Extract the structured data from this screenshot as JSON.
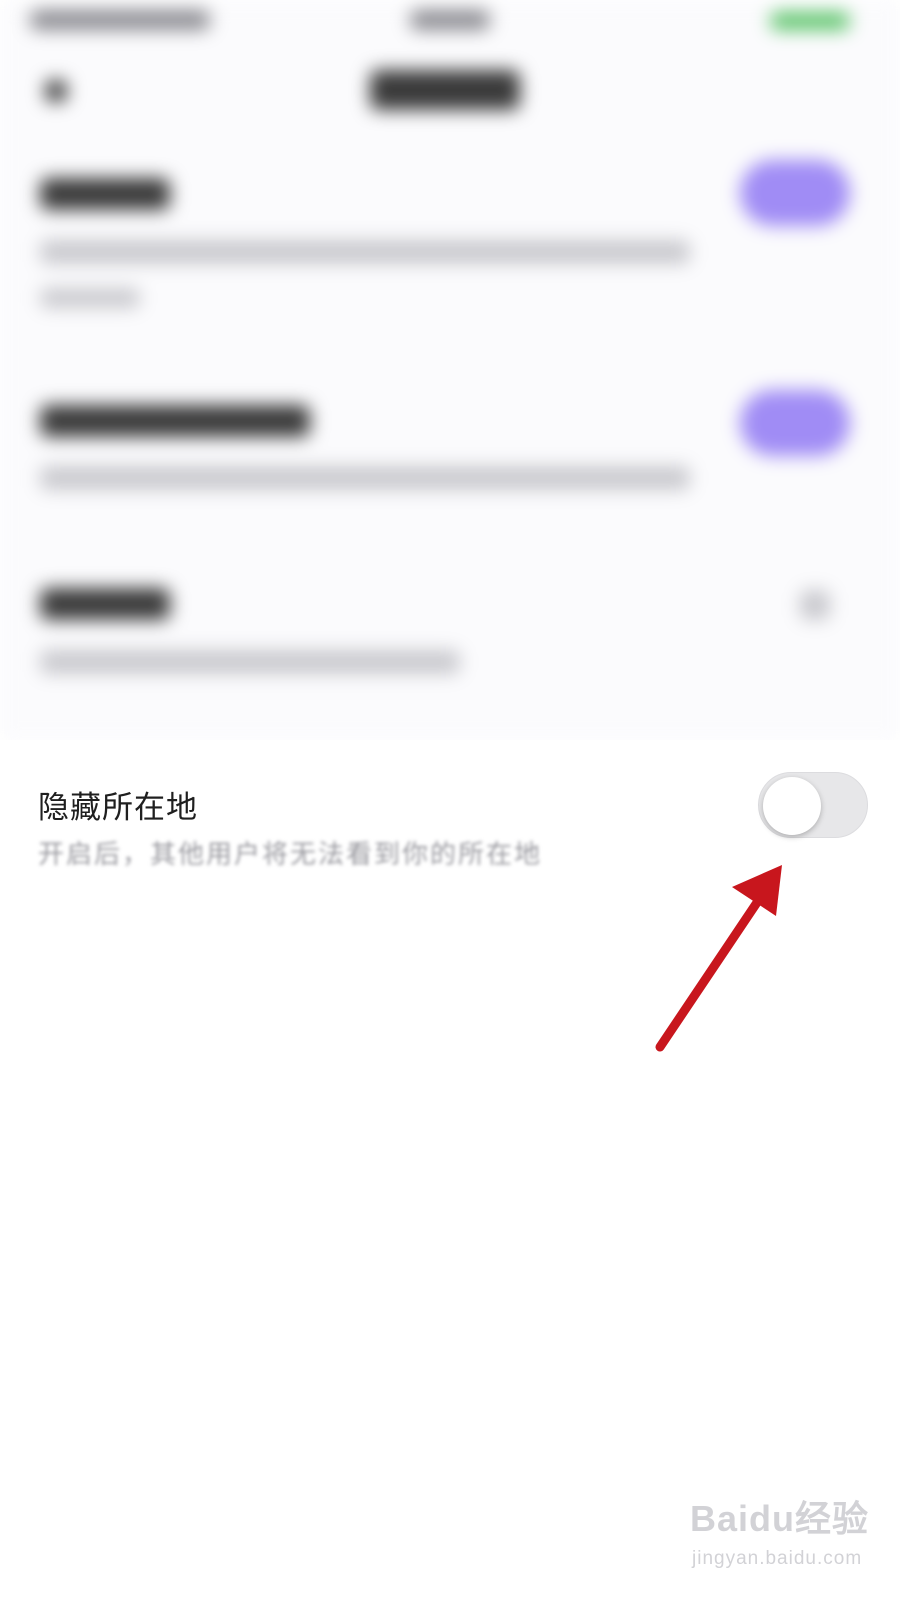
{
  "setting": {
    "title": "隐藏所在地",
    "description": "开启后，其他用户将无法看到你的所在地",
    "toggle_on": false
  },
  "colors": {
    "arrow": "#c8161d",
    "toggle_track": "#e7e7e9",
    "accent_blurred": "#a08cf5"
  },
  "watermark": {
    "brand": "Baidu经验",
    "url": "jingyan.baidu.com"
  }
}
